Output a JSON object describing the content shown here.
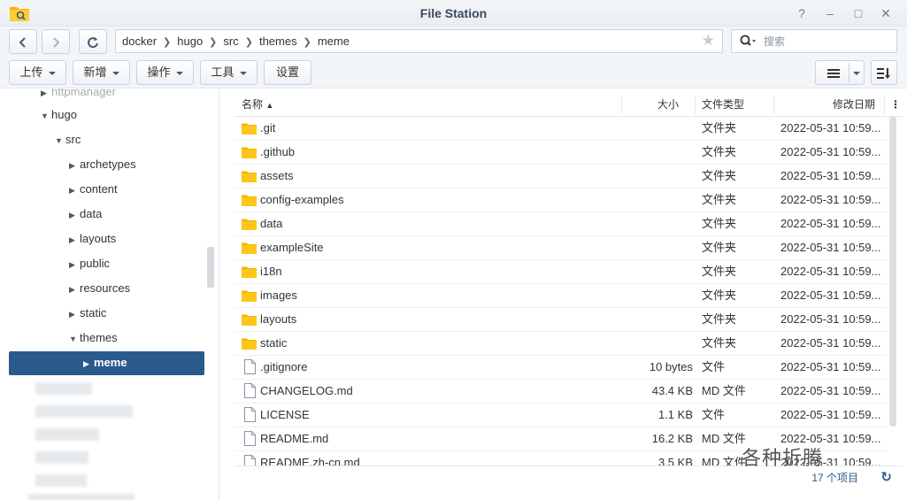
{
  "window": {
    "title": "File Station"
  },
  "nav": {
    "breadcrumb": [
      "docker",
      "hugo",
      "src",
      "themes",
      "meme"
    ],
    "search_placeholder": "搜索"
  },
  "toolbar": {
    "upload": "上传",
    "create": "新增",
    "action": "操作",
    "tools": "工具",
    "settings": "设置"
  },
  "sidebar": {
    "partial_top": "httpmanager",
    "items": [
      {
        "label": "hugo",
        "level": 1,
        "state": "expanded"
      },
      {
        "label": "src",
        "level": 2,
        "state": "expanded"
      },
      {
        "label": "archetypes",
        "level": 3,
        "state": "collapsed"
      },
      {
        "label": "content",
        "level": 3,
        "state": "collapsed"
      },
      {
        "label": "data",
        "level": 3,
        "state": "collapsed"
      },
      {
        "label": "layouts",
        "level": 3,
        "state": "collapsed"
      },
      {
        "label": "public",
        "level": 3,
        "state": "collapsed"
      },
      {
        "label": "resources",
        "level": 3,
        "state": "collapsed"
      },
      {
        "label": "static",
        "level": 3,
        "state": "collapsed"
      },
      {
        "label": "themes",
        "level": 3,
        "state": "expanded"
      },
      {
        "label": "meme",
        "level": 4,
        "state": "selected"
      }
    ]
  },
  "table": {
    "columns": {
      "name": "名称",
      "size": "大小",
      "type": "文件类型",
      "modified": "修改日期"
    },
    "rows": [
      {
        "name": ".git",
        "size": "",
        "type": "文件夹",
        "modified": "2022-05-31 10:59...",
        "kind": "folder"
      },
      {
        "name": ".github",
        "size": "",
        "type": "文件夹",
        "modified": "2022-05-31 10:59...",
        "kind": "folder"
      },
      {
        "name": "assets",
        "size": "",
        "type": "文件夹",
        "modified": "2022-05-31 10:59...",
        "kind": "folder"
      },
      {
        "name": "config-examples",
        "size": "",
        "type": "文件夹",
        "modified": "2022-05-31 10:59...",
        "kind": "folder"
      },
      {
        "name": "data",
        "size": "",
        "type": "文件夹",
        "modified": "2022-05-31 10:59...",
        "kind": "folder"
      },
      {
        "name": "exampleSite",
        "size": "",
        "type": "文件夹",
        "modified": "2022-05-31 10:59...",
        "kind": "folder"
      },
      {
        "name": "i18n",
        "size": "",
        "type": "文件夹",
        "modified": "2022-05-31 10:59...",
        "kind": "folder"
      },
      {
        "name": "images",
        "size": "",
        "type": "文件夹",
        "modified": "2022-05-31 10:59...",
        "kind": "folder"
      },
      {
        "name": "layouts",
        "size": "",
        "type": "文件夹",
        "modified": "2022-05-31 10:59...",
        "kind": "folder"
      },
      {
        "name": "static",
        "size": "",
        "type": "文件夹",
        "modified": "2022-05-31 10:59...",
        "kind": "folder"
      },
      {
        "name": ".gitignore",
        "size": "10 bytes",
        "type": "文件",
        "modified": "2022-05-31 10:59...",
        "kind": "file"
      },
      {
        "name": "CHANGELOG.md",
        "size": "43.4 KB",
        "type": "MD 文件",
        "modified": "2022-05-31 10:59...",
        "kind": "file"
      },
      {
        "name": "LICENSE",
        "size": "1.1 KB",
        "type": "文件",
        "modified": "2022-05-31 10:59...",
        "kind": "file"
      },
      {
        "name": "README.md",
        "size": "16.2 KB",
        "type": "MD 文件",
        "modified": "2022-05-31 10:59...",
        "kind": "file"
      },
      {
        "name": "README.zh-cn.md",
        "size": "3.5 KB",
        "type": "MD 文件",
        "modified": "2022-05-31 10:59...",
        "kind": "file"
      }
    ]
  },
  "footer": {
    "count": "17 个项目"
  },
  "watermark": "各种折腾",
  "colors": {
    "accent": "#2a5a8c",
    "folder": "#f5b400"
  }
}
